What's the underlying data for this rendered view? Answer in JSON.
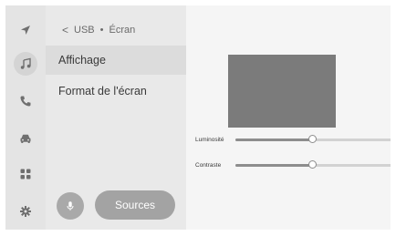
{
  "breadcrumb": {
    "back": "<",
    "source": "USB",
    "separator": "•",
    "page": "Écran"
  },
  "rail": {
    "items": [
      {
        "icon": "navigation-icon",
        "active": false
      },
      {
        "icon": "music-icon",
        "active": true
      },
      {
        "icon": "phone-icon",
        "active": false
      },
      {
        "icon": "car-icon",
        "active": false
      },
      {
        "icon": "apps-grid-icon",
        "active": false
      },
      {
        "icon": "settings-gear-icon",
        "active": false
      }
    ]
  },
  "menu": {
    "items": [
      {
        "label": "Affichage",
        "selected": true
      },
      {
        "label": "Format de l'écran",
        "selected": false
      }
    ]
  },
  "bottom": {
    "mic_icon": "microphone-icon",
    "sources_label": "Sources"
  },
  "settings": {
    "sliders": [
      {
        "label": "Luminosité",
        "level": 0.49
      },
      {
        "label": "Contraste",
        "level": 0.49
      }
    ]
  },
  "colors": {
    "background": "#efefef",
    "preview": "#7b7b7b",
    "button": "#a3a3a3",
    "selected": "#dcdcdc"
  }
}
